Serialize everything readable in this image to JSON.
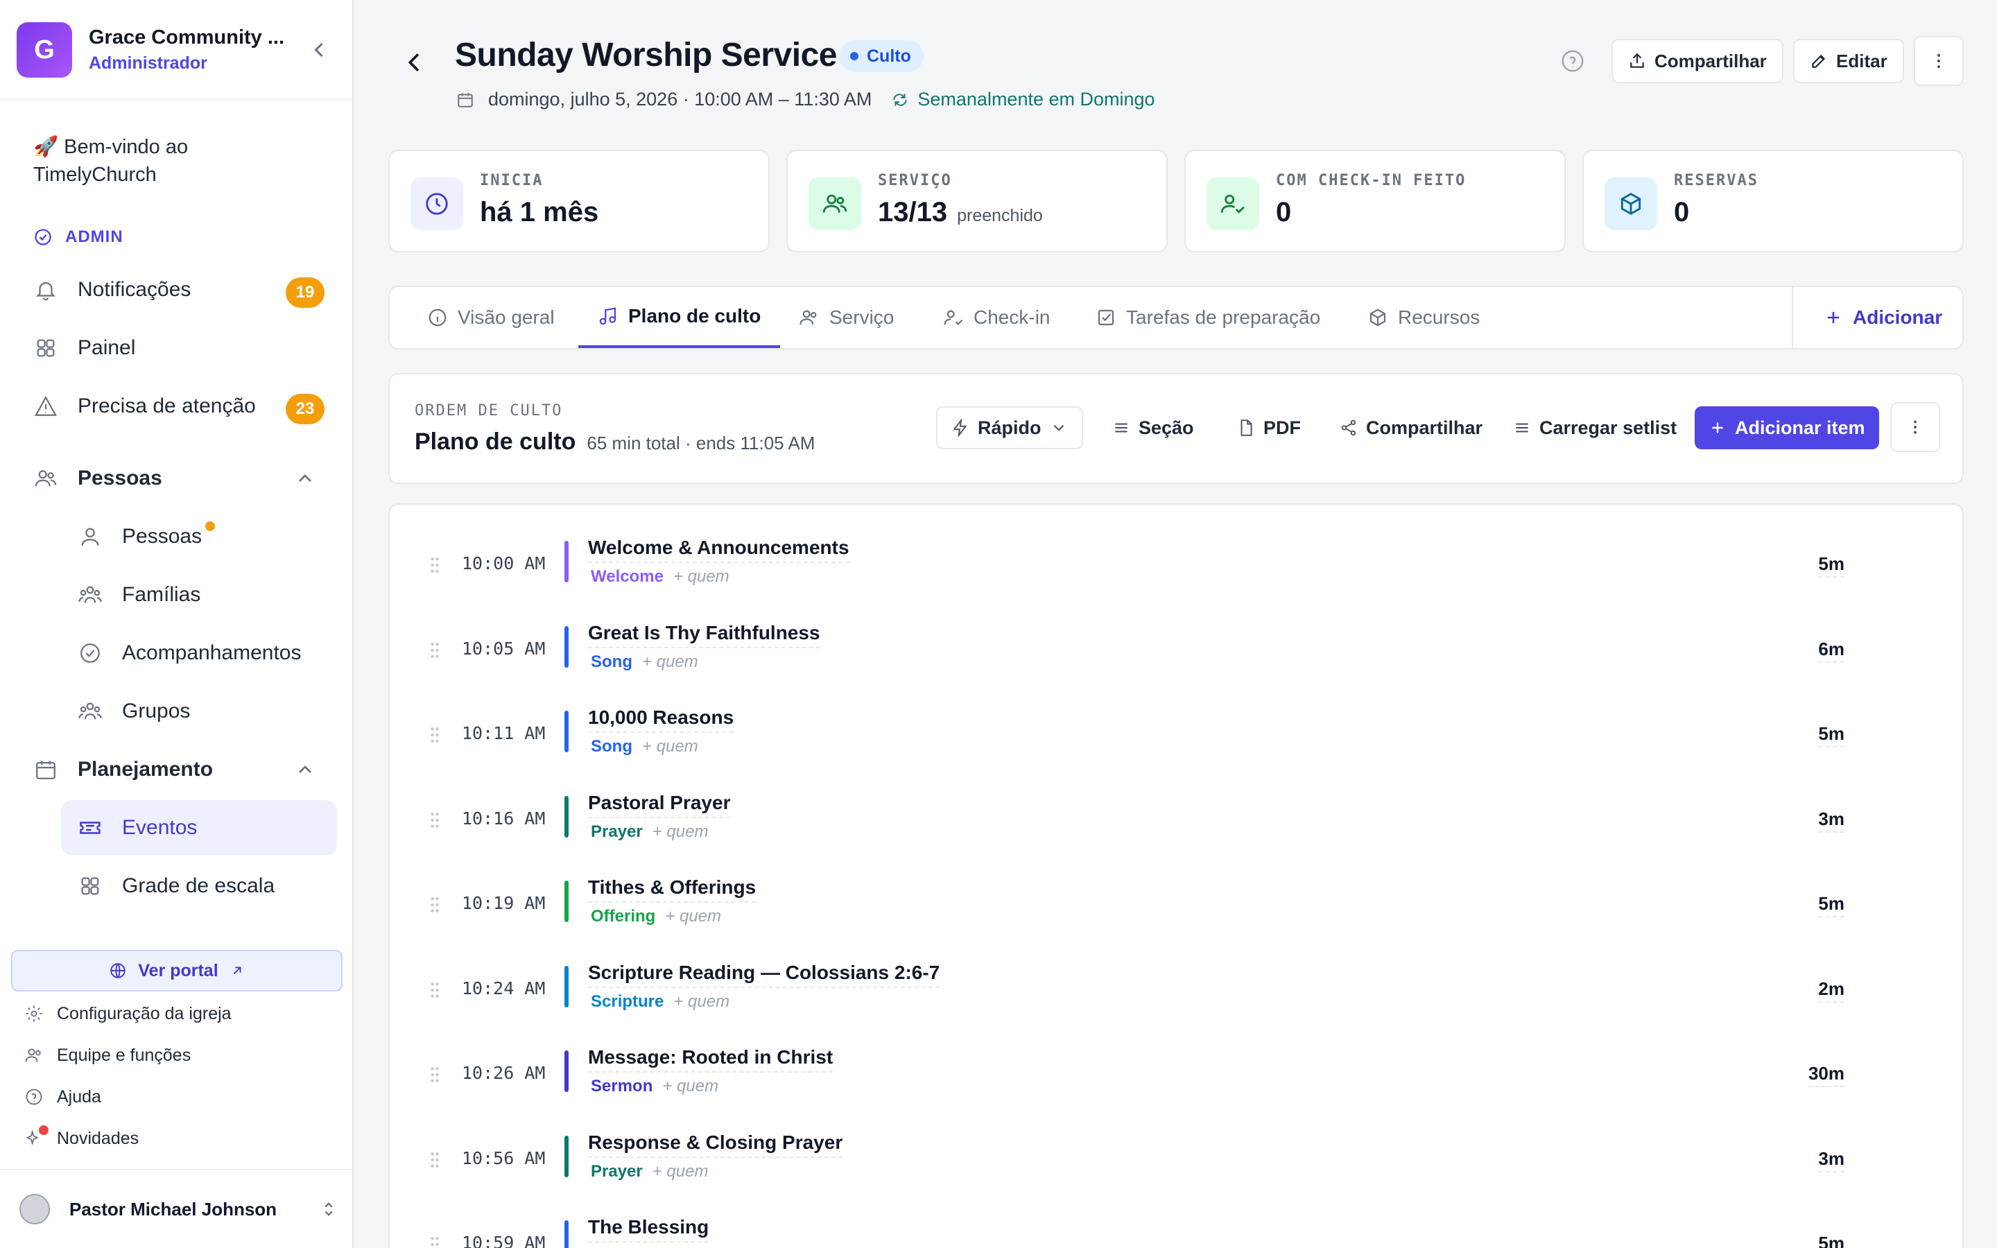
{
  "sidebar": {
    "org_initial": "G",
    "org_name": "Grace Community ...",
    "org_role": "Administrador",
    "welcome": "🚀 Bem-vindo ao TimelyChurch",
    "admin_label": "ADMIN",
    "notifications": {
      "label": "Notificações",
      "count": "19"
    },
    "dashboard": {
      "label": "Painel"
    },
    "attention": {
      "label": "Precisa de atenção",
      "count": "23"
    },
    "people_group": {
      "label": "Pessoas"
    },
    "people_items": [
      {
        "label": "Pessoas"
      },
      {
        "label": "Famílias"
      },
      {
        "label": "Acompanhamentos"
      },
      {
        "label": "Grupos"
      }
    ],
    "planning_group": {
      "label": "Planejamento"
    },
    "planning_items": [
      {
        "label": "Eventos"
      },
      {
        "label": "Grade de escala"
      }
    ],
    "portal_label": "Ver portal",
    "footer_items": [
      {
        "label": "Configuração da igreja"
      },
      {
        "label": "Equipe e funções"
      },
      {
        "label": "Ajuda"
      },
      {
        "label": "Novidades"
      }
    ],
    "user_name": "Pastor Michael Johnson"
  },
  "header": {
    "title": "Sunday Worship Service",
    "type_label": "Culto",
    "datetime": "domingo, julho 5, 2026 · 10:00 AM – 11:30 AM",
    "recurrence": "Semanalmente em Domingo",
    "share_label": "Compartilhar",
    "edit_label": "Editar"
  },
  "stats": [
    {
      "label": "INICIA",
      "value": "há 1 mês",
      "sub": ""
    },
    {
      "label": "SERVIÇO",
      "value": "13/13",
      "sub": "preenchido"
    },
    {
      "label": "COM CHECK-IN FEITO",
      "value": "0",
      "sub": ""
    },
    {
      "label": "RESERVAS",
      "value": "0",
      "sub": ""
    }
  ],
  "tabs": [
    {
      "label": "Visão geral"
    },
    {
      "label": "Plano de culto"
    },
    {
      "label": "Serviço"
    },
    {
      "label": "Check-in"
    },
    {
      "label": "Tarefas de preparação"
    },
    {
      "label": "Recursos"
    }
  ],
  "tab_add_label": "Adicionar",
  "plan": {
    "eyebrow": "ORDEM DE CULTO",
    "title": "Plano de culto",
    "meta": "65 min total · ends 11:05 AM",
    "quick_label": "Rápido",
    "section_label": "Seção",
    "pdf_label": "PDF",
    "share_label": "Compartilhar",
    "setlist_label": "Carregar setlist",
    "add_item_label": "Adicionar item"
  },
  "items": [
    {
      "time": "10:00 AM",
      "title": "Welcome & Announcements",
      "category": "Welcome",
      "who": "+ quem",
      "duration": "5m",
      "color": "#8b5cf6"
    },
    {
      "time": "10:05 AM",
      "title": "Great Is Thy Faithfulness",
      "category": "Song",
      "who": "+ quem",
      "duration": "6m",
      "color": "#2563eb"
    },
    {
      "time": "10:11 AM",
      "title": "10,000 Reasons",
      "category": "Song",
      "who": "+ quem",
      "duration": "5m",
      "color": "#2563eb"
    },
    {
      "time": "10:16 AM",
      "title": "Pastoral Prayer",
      "category": "Prayer",
      "who": "+ quem",
      "duration": "3m",
      "color": "#0f766e"
    },
    {
      "time": "10:19 AM",
      "title": "Tithes & Offerings",
      "category": "Offering",
      "who": "+ quem",
      "duration": "5m",
      "color": "#16a34a"
    },
    {
      "time": "10:24 AM",
      "title": "Scripture Reading — Colossians 2:6-7",
      "category": "Scripture",
      "who": "+ quem",
      "duration": "2m",
      "color": "#0284c7"
    },
    {
      "time": "10:26 AM",
      "title": "Message: Rooted in Christ",
      "category": "Sermon",
      "who": "+ quem",
      "duration": "30m",
      "color": "#4338ca"
    },
    {
      "time": "10:56 AM",
      "title": "Response & Closing Prayer",
      "category": "Prayer",
      "who": "+ quem",
      "duration": "3m",
      "color": "#0f766e"
    },
    {
      "time": "10:59 AM",
      "title": "The Blessing",
      "category": "",
      "who": "",
      "duration": "5m",
      "color": "#2563eb"
    }
  ]
}
